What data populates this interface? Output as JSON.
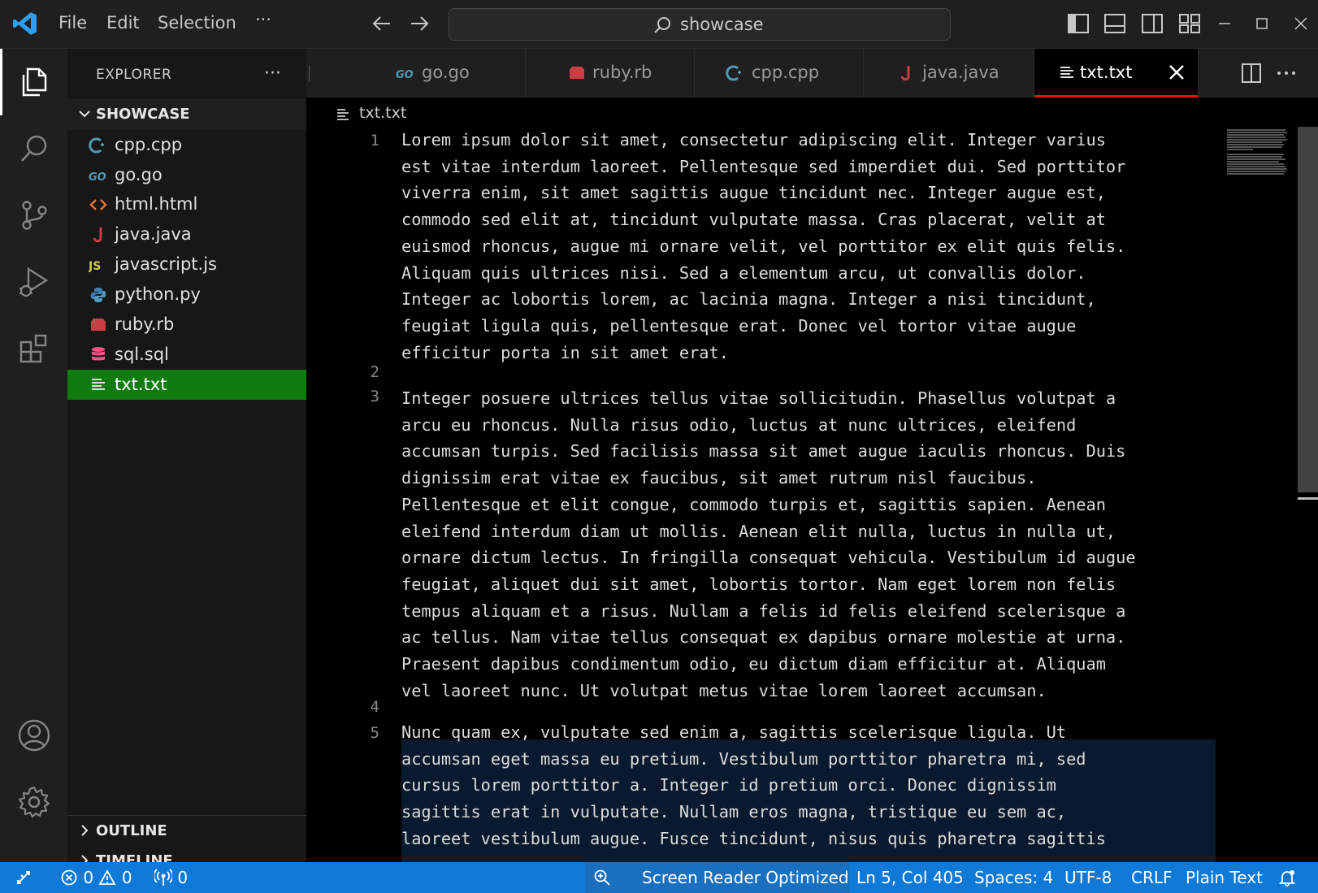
{
  "titlebar": {
    "menu": [
      "File",
      "Edit",
      "Selection",
      "···"
    ],
    "search_text": "showcase"
  },
  "activity_bar": [
    "explorer",
    "search",
    "source-control",
    "run-and-debug",
    "extensions",
    "accounts",
    "manage"
  ],
  "sidebar": {
    "title": "EXPLORER",
    "more": "···",
    "folder": "SHOWCASE",
    "files": [
      {
        "name": "cpp.cpp",
        "icon": "cpp-icon",
        "color": "#519aba"
      },
      {
        "name": "go.go",
        "icon": "go-icon",
        "color": "#519aba"
      },
      {
        "name": "html.html",
        "icon": "html-icon",
        "color": "#e37933"
      },
      {
        "name": "java.java",
        "icon": "java-icon",
        "color": "#cc3e44"
      },
      {
        "name": "javascript.js",
        "icon": "javascript-icon",
        "color": "#cbcb41"
      },
      {
        "name": "python.py",
        "icon": "python-icon",
        "color": "#519aba"
      },
      {
        "name": "ruby.rb",
        "icon": "ruby-icon",
        "color": "#cc3e44"
      },
      {
        "name": "sql.sql",
        "icon": "database-icon",
        "color": "#f55385"
      },
      {
        "name": "txt.txt",
        "icon": "text-file-icon",
        "color": "#cccccc",
        "selected": true
      }
    ],
    "outline": "OUTLINE",
    "timeline": "TIMELINE"
  },
  "tabs": [
    {
      "label": "go.go",
      "icon": "go-icon"
    },
    {
      "label": "ruby.rb",
      "icon": "ruby-icon"
    },
    {
      "label": "cpp.cpp",
      "icon": "cpp-icon"
    },
    {
      "label": "java.java",
      "icon": "java-icon"
    },
    {
      "label": "txt.txt",
      "icon": "text-file-icon",
      "active": true
    }
  ],
  "breadcrumb": "txt.txt",
  "editor": {
    "line_numbers": [
      "1",
      "2",
      "3",
      "4",
      "5"
    ],
    "lines": [
      "Lorem ipsum dolor sit amet, consectetur adipiscing elit. Integer varius\nest vitae interdum laoreet. Pellentesque sed imperdiet dui. Sed porttitor\nviverra enim, sit amet sagittis augue tincidunt nec. Integer augue est,\ncommodo sed elit at, tincidunt vulputate massa. Cras placerat, velit at\neuismod rhoncus, augue mi ornare velit, vel porttitor ex elit quis felis.\nAliquam quis ultrices nisi. Sed a elementum arcu, ut convallis dolor.\nInteger ac lobortis lorem, ac lacinia magna. Integer a nisi tincidunt,\nfeugiat ligula quis, pellentesque erat. Donec vel tortor vitae augue\nefficitur porta in sit amet erat.",
      "",
      "Integer posuere ultrices tellus vitae sollicitudin. Phasellus volutpat a\narcu eu rhoncus. Nulla risus odio, luctus at nunc ultrices, eleifend\naccumsan turpis. Sed facilisis massa sit amet augue iaculis rhoncus. Duis\ndignissim erat vitae ex faucibus, sit amet rutrum nisl faucibus.\nPellentesque et elit congue, commodo turpis et, sagittis sapien. Aenean\neleifend interdum diam ut mollis. Aenean elit nulla, luctus in nulla ut,\nornare dictum lectus. In fringilla consequat vehicula. Vestibulum id augue\nfeugiat, aliquet dui sit amet, lobortis tortor. Nam eget lorem non felis\ntempus aliquam et a risus. Nullam a felis id felis eleifend scelerisque a\nac tellus. Nam vitae tellus consequat ex dapibus ornare molestie at urna.\nPraesent dapibus condimentum odio, eu dictum diam efficitur at. Aliquam\nvel laoreet nunc. Ut volutpat metus vitae lorem laoreet accumsan.",
      "",
      "Nunc quam ex, vulputate sed enim a, sagittis scelerisque ligula. Ut\naccumsan eget massa eu pretium. Vestibulum porttitor pharetra mi, sed\ncursus lorem porttitor a. Integer id pretium orci. Donec dignissim\nsagittis erat in vulputate. Nullam eros magna, tristique eu sem ac,\nlaoreet vestibulum augue. Fusce tincidunt, nisus quis pharetra sagittis"
    ]
  },
  "statusbar": {
    "errors": "0",
    "warnings": "0",
    "ports": "0",
    "screen_reader": "Screen Reader Optimized",
    "position": "Ln 5, Col 405",
    "spaces": "Spaces: 4",
    "encoding": "UTF-8",
    "eol": "CRLF",
    "language": "Plain Text"
  },
  "colors": {
    "accent_blue": "#0e79d6",
    "selected_green": "#107c10",
    "active_tab_border": "#e51400"
  }
}
